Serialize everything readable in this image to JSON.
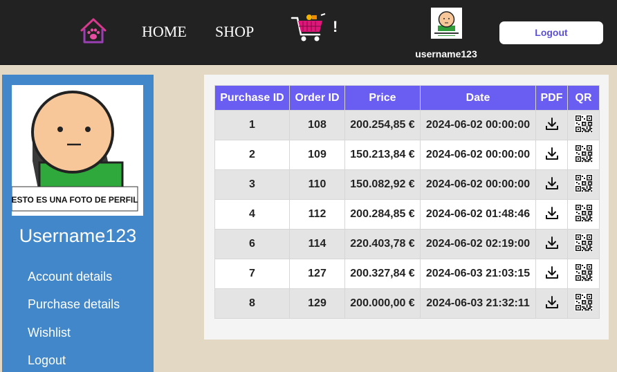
{
  "header": {
    "nav": {
      "home": "HOME",
      "shop": "SHOP"
    },
    "cart_badge": "!",
    "username": "username123",
    "logout_label": "Logout"
  },
  "sidebar": {
    "profile_caption": "ESTO ES UNA FOTO DE PERFIL",
    "profile_name": "Username123",
    "items": [
      {
        "label": "Account details"
      },
      {
        "label": "Purchase details"
      },
      {
        "label": "Wishlist"
      },
      {
        "label": "Logout"
      }
    ]
  },
  "table": {
    "headers": [
      "Purchase ID",
      "Order ID",
      "Price",
      "Date",
      "PDF",
      "QR"
    ],
    "rows": [
      {
        "purchase_id": "1",
        "order_id": "108",
        "price": "200.254,85 €",
        "date": "2024-06-02 00:00:00"
      },
      {
        "purchase_id": "2",
        "order_id": "109",
        "price": "150.213,84 €",
        "date": "2024-06-02 00:00:00"
      },
      {
        "purchase_id": "3",
        "order_id": "110",
        "price": "150.082,92 €",
        "date": "2024-06-02 00:00:00"
      },
      {
        "purchase_id": "4",
        "order_id": "112",
        "price": "200.284,85 €",
        "date": "2024-06-02 01:48:46"
      },
      {
        "purchase_id": "6",
        "order_id": "114",
        "price": "220.403,78 €",
        "date": "2024-06-02 02:19:00"
      },
      {
        "purchase_id": "7",
        "order_id": "127",
        "price": "200.327,84 €",
        "date": "2024-06-03 21:03:15"
      },
      {
        "purchase_id": "8",
        "order_id": "129",
        "price": "200.000,00 €",
        "date": "2024-06-03 21:32:11"
      }
    ]
  },
  "colors": {
    "header_bg": "#222222",
    "page_bg": "#e2d8c3",
    "sidebar_bg": "#4287c9",
    "table_header_bg": "#6a5df1",
    "logout_text": "#5a4fd6",
    "home_icon": "#d63a8c",
    "cart_icon": "#e0157a"
  },
  "icons": {
    "home": "paw-house-icon",
    "cart": "shopping-cart-icon",
    "pdf": "download-icon",
    "qr": "qr-code-icon"
  }
}
